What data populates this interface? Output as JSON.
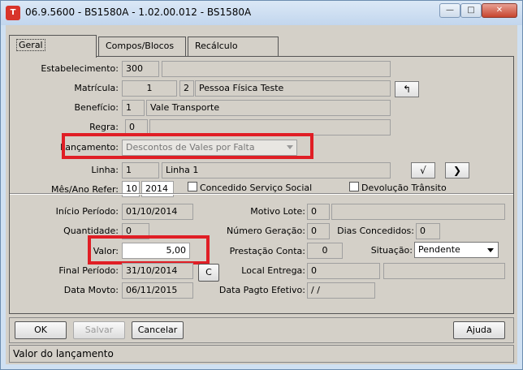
{
  "window": {
    "title": "06.9.5600 - BS1580A - 1.02.00.012 - BS1580A",
    "icon_text": "T"
  },
  "tabs": [
    {
      "label": "Geral"
    },
    {
      "label": "Compos/Blocos"
    },
    {
      "label": "Recálculo"
    }
  ],
  "fields": {
    "estabelecimento": {
      "label": "Estabelecimento:",
      "value": "300",
      "desc": ""
    },
    "matricula": {
      "label": "Matrícula:",
      "value": "1",
      "seq": "2",
      "desc": "Pessoa Física Teste"
    },
    "beneficio": {
      "label": "Benefício:",
      "value": "1",
      "desc": "Vale Transporte"
    },
    "regra": {
      "label": "Regra:",
      "value": "0",
      "desc": ""
    },
    "lancamento": {
      "label": "Lançamento:",
      "value": "Descontos de Vales por Falta"
    },
    "linha": {
      "label": "Linha:",
      "value": "1",
      "desc": "Linha 1"
    },
    "mes_ano": {
      "label": "Mês/Ano Refer:",
      "mes": "10",
      "ano": "2014"
    },
    "concedido_label": "Concedido Serviço Social",
    "devolucao_label": "Devolução Trânsito",
    "inicio_periodo": {
      "label": "Início Período:",
      "value": "01/10/2014"
    },
    "motivo_lote": {
      "label": "Motivo Lote:",
      "value": "0",
      "desc": ""
    },
    "quantidade": {
      "label": "Quantidade:",
      "value": "0"
    },
    "numero_geracao": {
      "label": "Número Geração:",
      "value": "0"
    },
    "dias_concedidos": {
      "label": "Dias Concedidos:",
      "value": "0"
    },
    "valor": {
      "label": "Valor:",
      "value": "5,00"
    },
    "prestacao_conta": {
      "label": "Prestação Conta:",
      "value": "0"
    },
    "situacao": {
      "label": "Situação:",
      "value": "Pendente"
    },
    "final_periodo": {
      "label": "Final Período:",
      "value": "31/10/2014"
    },
    "local_entrega": {
      "label": "Local Entrega:",
      "value": "0",
      "desc": ""
    },
    "data_movto": {
      "label": "Data Movto:",
      "value": "06/11/2015"
    },
    "data_pagto": {
      "label": "Data Pagto Efetivo:",
      "value": "/ /"
    }
  },
  "buttons": {
    "ok": "OK",
    "salvar": "Salvar",
    "cancelar": "Cancelar",
    "ajuda": "Ajuda",
    "c": "C"
  },
  "status_text": "Valor do lançamento",
  "highlight_color": "#e01e25"
}
